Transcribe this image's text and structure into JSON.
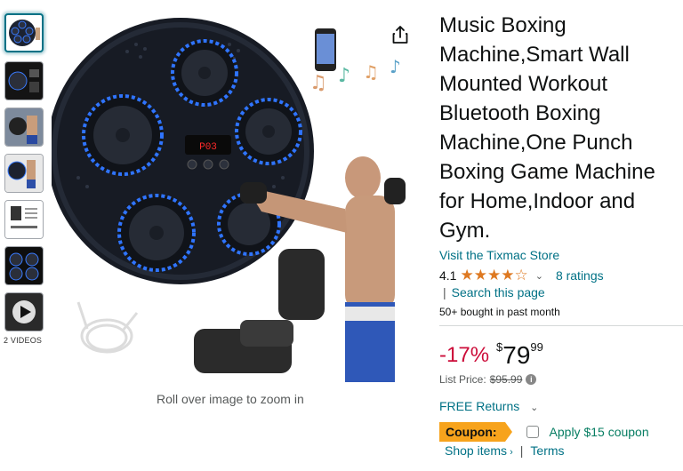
{
  "product": {
    "title": "Music Boxing Machine,Smart Wall Mounted Workout Bluetooth Boxing Machine,One Punch Boxing Game Machine for Home,Indoor and Gym.",
    "store_link": "Visit the Tixmac Store",
    "rating": "4.1",
    "rating_stars_value": 4.1,
    "ratings_count": "8 ratings",
    "search_sep": "|",
    "search_page": "Search this page",
    "bought": "50+ bought in past month"
  },
  "price": {
    "discount": "-17%",
    "currency": "$",
    "whole": "79",
    "fraction": "99",
    "list_label": "List Price:",
    "list_value": "$95.99"
  },
  "returns": {
    "label": "FREE Returns"
  },
  "coupon": {
    "tag": "Coupon:",
    "text": "Apply $15 coupon"
  },
  "links": {
    "shop": "Shop items",
    "sep": "|",
    "terms": "Terms"
  },
  "gallery": {
    "videos_label": "2 VIDEOS",
    "zoom_hint": "Roll over image to zoom in",
    "device_display": "P03"
  },
  "colors": {
    "link": "#007185",
    "deal": "#cc0c39",
    "star": "#de7921",
    "coupon": "#f7a31c",
    "coupon_text": "#067d62"
  },
  "icons": [
    "share-icon",
    "star-icon",
    "chevron-down-icon",
    "info-icon",
    "checkbox",
    "play-icon"
  ]
}
